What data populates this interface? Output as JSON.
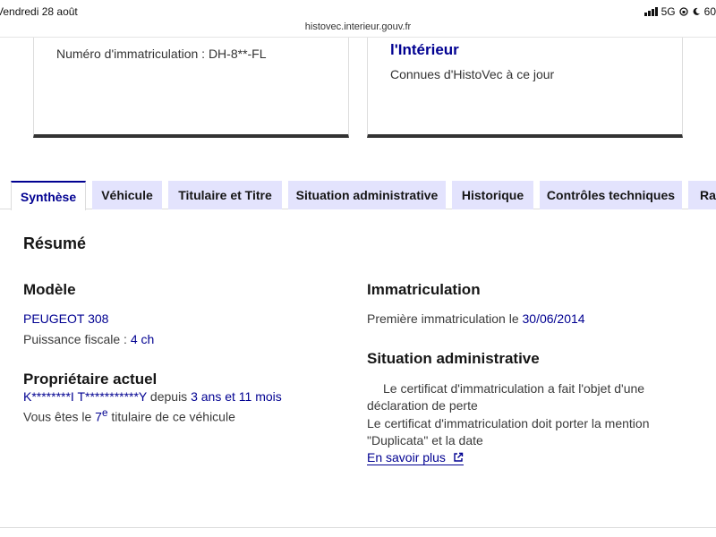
{
  "status": {
    "time": "Vendredi 28 août",
    "network": "5G",
    "battery": "60"
  },
  "browser": {
    "url": "histovec.interieur.gouv.fr"
  },
  "cards": {
    "left": {
      "plate_label": "Numéro d'immatriculation : DH-8**-FL"
    },
    "right": {
      "title": "l'Intérieur",
      "subtitle": "Connues d'HistoVec à ce jour"
    }
  },
  "tabs": [
    {
      "label": "Synthèse",
      "active": true
    },
    {
      "label": "Véhicule"
    },
    {
      "label": "Titulaire et Titre"
    },
    {
      "label": "Situation administrative"
    },
    {
      "label": "Historique"
    },
    {
      "label": "Contrôles techniques"
    },
    {
      "label": "Rap"
    }
  ],
  "summary": {
    "heading": "Résumé",
    "model": {
      "heading": "Modèle",
      "name": "PEUGEOT 308",
      "power_label": "Puissance fiscale : ",
      "power_value": "4 ch"
    },
    "owner": {
      "heading": "Propriétaire actuel",
      "name": "K********I T***********Y",
      "since_label": " depuis ",
      "since_value": "3 ans et 11 mois",
      "rank_prefix": "Vous êtes le ",
      "rank_value": "7",
      "rank_sup": "e",
      "rank_suffix": " titulaire de ce véhicule"
    },
    "registration": {
      "heading": "Immatriculation",
      "first_label": "Première immatriculation le ",
      "first_value": "30/06/2014"
    },
    "admin": {
      "heading": "Situation administrative",
      "line1": "Le certificat d'immatriculation a fait l'objet d'une",
      "line2": "déclaration de perte",
      "line3": "Le certificat d'immatriculation doit porter la mention",
      "line4": "\"Duplicata\" et la date",
      "link": "En savoir plus"
    }
  },
  "icons": {
    "external": "external-link-icon",
    "moon": "moon-icon",
    "lock_rotation": "orientation-lock-icon"
  },
  "colors": {
    "accent": "#000091",
    "tab_bg": "#e3e3fd"
  }
}
